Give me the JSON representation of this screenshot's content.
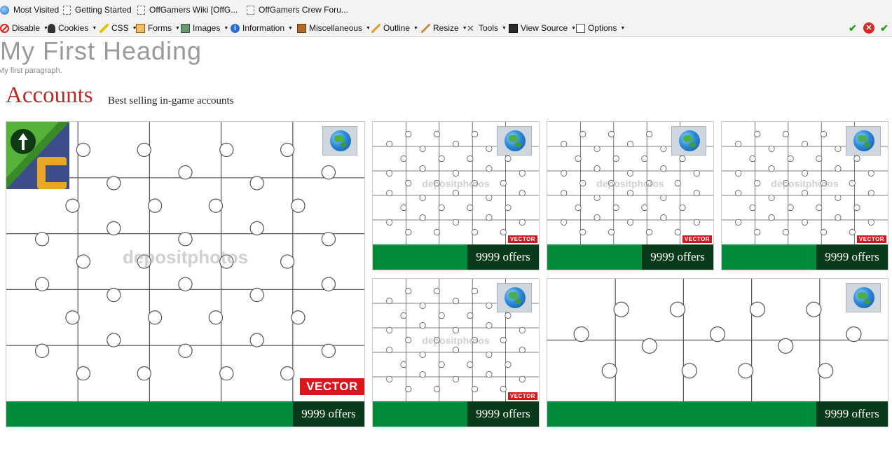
{
  "bookmarks": {
    "most_visited": "Most Visited",
    "getting_started": "Getting Started",
    "wiki": "OffGamers Wiki [OffG...",
    "forum": "OffGamers Crew Foru..."
  },
  "devbar": {
    "items": [
      "Disable",
      "Cookies",
      "CSS",
      "Forms",
      "Images",
      "Information",
      "Miscellaneous",
      "Outline",
      "Resize",
      "Tools",
      "View Source",
      "Options"
    ]
  },
  "page": {
    "heading": "My First Heading",
    "paragraph": "My first paragraph."
  },
  "accounts": {
    "title": "Accounts",
    "subtitle": "Best selling in-game accounts",
    "watermark": "depositphotos",
    "vector_badge": "VECTOR",
    "cards": [
      {
        "offers": "9999 offers"
      },
      {
        "offers": "9999 offers"
      },
      {
        "offers": "9999 offers"
      },
      {
        "offers": "9999 offers"
      },
      {
        "offers": "9999 offers"
      },
      {
        "offers": "9999 offers"
      }
    ]
  },
  "colors": {
    "accent_red": "#b42a25",
    "footer_green": "#008a3a",
    "offers_dark": "#063a19",
    "vector_red": "#d8171c"
  }
}
